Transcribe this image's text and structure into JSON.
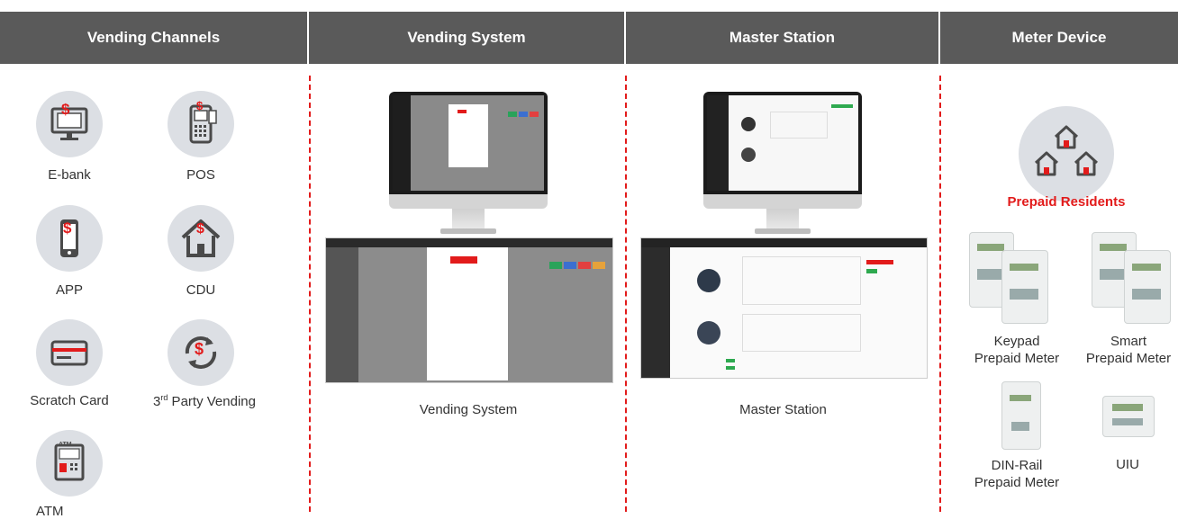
{
  "header": {
    "col1": "Vending Channels",
    "col2": "Vending System",
    "col3": "Master Station",
    "col4": "Meter Device"
  },
  "channels": {
    "ebank": "E-bank",
    "pos": "POS",
    "app": "APP",
    "cdu": "CDU",
    "scratch": "Scratch Card",
    "third_party_prefix": "3",
    "third_party_sup": "rd",
    "third_party_suffix": " Party Vending",
    "atm": "ATM",
    "atm_screen_text": "ATM",
    "dollar": "$"
  },
  "vending_system": {
    "caption": "Vending System"
  },
  "master_station": {
    "caption": "Master Station"
  },
  "meter_device": {
    "residents": "Prepaid Residents",
    "keypad_line1": "Keypad",
    "keypad_line2": "Prepaid Meter",
    "smart_line1": "Smart",
    "smart_line2": "Prepaid Meter",
    "dinrail_line1": "DIN-Rail",
    "dinrail_line2": "Prepaid Meter",
    "uiu": "UIU"
  },
  "colors": {
    "header_bg": "#5a5a5a",
    "accent_red": "#e21b1b",
    "icon_bg": "#dcdfe4",
    "icon_dark": "#4a4a4a"
  }
}
